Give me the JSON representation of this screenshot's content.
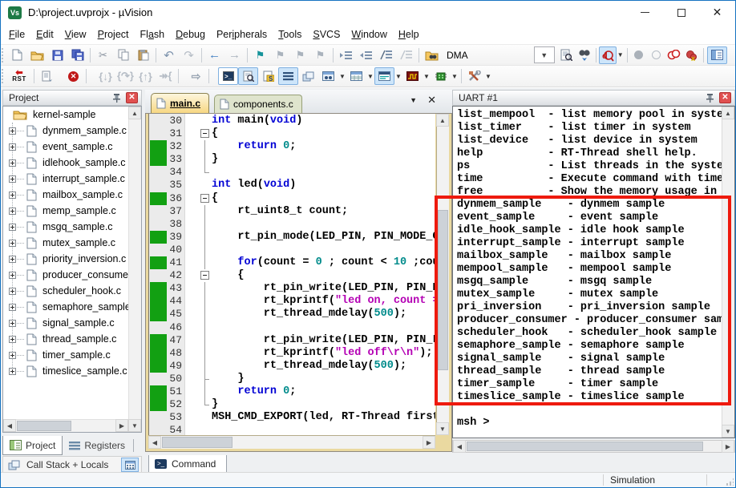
{
  "titlebar": {
    "title": "D:\\project.uvprojx - µVision",
    "icon_text": "Vs"
  },
  "menu": {
    "items": [
      {
        "pre": "",
        "u": "F",
        "post": "ile"
      },
      {
        "pre": "",
        "u": "E",
        "post": "dit"
      },
      {
        "pre": "",
        "u": "V",
        "post": "iew"
      },
      {
        "pre": "",
        "u": "P",
        "post": "roject"
      },
      {
        "pre": "Fl",
        "u": "a",
        "post": "sh"
      },
      {
        "pre": "",
        "u": "D",
        "post": "ebug"
      },
      {
        "pre": "Per",
        "u": "i",
        "post": "pherals"
      },
      {
        "pre": "",
        "u": "T",
        "post": "ools"
      },
      {
        "pre": "",
        "u": "S",
        "post": "VCS"
      },
      {
        "pre": "",
        "u": "W",
        "post": "indow"
      },
      {
        "pre": "",
        "u": "H",
        "post": "elp"
      }
    ]
  },
  "toolbar": {
    "combo_value": "DMA",
    "rst_label": "RST"
  },
  "project_panel": {
    "title": "Project",
    "root": "kernel-sample",
    "files": [
      "dynmem_sample.c",
      "event_sample.c",
      "idlehook_sample.c",
      "interrupt_sample.c",
      "mailbox_sample.c",
      "memp_sample.c",
      "msgq_sample.c",
      "mutex_sample.c",
      "priority_inversion.c",
      "producer_consumer.c",
      "scheduler_hook.c",
      "semaphore_sample.c",
      "signal_sample.c",
      "thread_sample.c",
      "timer_sample.c",
      "timeslice_sample.c"
    ],
    "tabs": {
      "project": "Project",
      "registers": "Registers"
    },
    "callstack_label": "Call Stack + Locals"
  },
  "editor": {
    "tabs": {
      "tab1": "main.c",
      "tab2": "components.c"
    },
    "command_tab": "Command",
    "lines": [
      {
        "n": 30,
        "g": false,
        "f": "",
        "segs": [
          [
            "k",
            "int"
          ],
          [
            "p",
            " main("
          ],
          [
            "k",
            "void"
          ],
          [
            "p",
            ")"
          ]
        ]
      },
      {
        "n": 31,
        "g": false,
        "f": "box",
        "segs": [
          [
            "p",
            "{"
          ]
        ]
      },
      {
        "n": 32,
        "g": true,
        "f": "v",
        "segs": [
          [
            "p",
            "    "
          ],
          [
            "k",
            "return"
          ],
          [
            "p",
            " "
          ],
          [
            "n",
            "0"
          ],
          [
            "p",
            ";"
          ]
        ]
      },
      {
        "n": 33,
        "g": true,
        "f": "v",
        "segs": [
          [
            "p",
            "}"
          ]
        ]
      },
      {
        "n": 34,
        "g": false,
        "f": "end",
        "segs": []
      },
      {
        "n": 35,
        "g": false,
        "f": "",
        "segs": [
          [
            "k",
            "int"
          ],
          [
            "p",
            " led("
          ],
          [
            "k",
            "void"
          ],
          [
            "p",
            ")"
          ]
        ]
      },
      {
        "n": 36,
        "g": true,
        "f": "box",
        "segs": [
          [
            "p",
            "{"
          ]
        ]
      },
      {
        "n": 37,
        "g": false,
        "f": "v",
        "segs": [
          [
            "p",
            "    rt_uint8_t count;"
          ]
        ]
      },
      {
        "n": 38,
        "g": false,
        "f": "v",
        "segs": []
      },
      {
        "n": 39,
        "g": true,
        "f": "v",
        "segs": [
          [
            "p",
            "    rt_pin_mode(LED_PIN, PIN_MODE_OUTPUT);"
          ]
        ]
      },
      {
        "n": 40,
        "g": false,
        "f": "v",
        "segs": []
      },
      {
        "n": 41,
        "g": true,
        "f": "v",
        "segs": [
          [
            "p",
            "    "
          ],
          [
            "k",
            "for"
          ],
          [
            "p",
            "(count = "
          ],
          [
            "n",
            "0"
          ],
          [
            "p",
            " ; count < "
          ],
          [
            "n",
            "10"
          ],
          [
            "p",
            " ;count++)"
          ]
        ]
      },
      {
        "n": 42,
        "g": false,
        "f": "box",
        "segs": [
          [
            "p",
            "    {"
          ]
        ]
      },
      {
        "n": 43,
        "g": true,
        "f": "v",
        "segs": [
          [
            "p",
            "        rt_pin_write(LED_PIN, PIN_HIGH);"
          ]
        ]
      },
      {
        "n": 44,
        "g": true,
        "f": "v",
        "segs": [
          [
            "p",
            "        rt_kprintf("
          ],
          [
            "s",
            "\"led on, count = %d\\r\\n\""
          ],
          [
            "p",
            ", count);"
          ]
        ]
      },
      {
        "n": 45,
        "g": true,
        "f": "v",
        "segs": [
          [
            "p",
            "        rt_thread_mdelay("
          ],
          [
            "n",
            "500"
          ],
          [
            "p",
            ");"
          ]
        ]
      },
      {
        "n": 46,
        "g": false,
        "f": "v",
        "segs": []
      },
      {
        "n": 47,
        "g": true,
        "f": "v",
        "segs": [
          [
            "p",
            "        rt_pin_write(LED_PIN, PIN_LOW);"
          ]
        ]
      },
      {
        "n": 48,
        "g": true,
        "f": "v",
        "segs": [
          [
            "p",
            "        rt_kprintf("
          ],
          [
            "s",
            "\"led off\\r\\n\""
          ],
          [
            "p",
            ");"
          ]
        ]
      },
      {
        "n": 49,
        "g": true,
        "f": "v",
        "segs": [
          [
            "p",
            "        rt_thread_mdelay("
          ],
          [
            "n",
            "500"
          ],
          [
            "p",
            ");"
          ]
        ]
      },
      {
        "n": 50,
        "g": false,
        "f": "vend",
        "segs": [
          [
            "p",
            "    }"
          ]
        ]
      },
      {
        "n": 51,
        "g": true,
        "f": "v",
        "segs": [
          [
            "p",
            "    "
          ],
          [
            "k",
            "return"
          ],
          [
            "p",
            " "
          ],
          [
            "n",
            "0"
          ],
          [
            "p",
            ";"
          ]
        ]
      },
      {
        "n": 52,
        "g": true,
        "f": "end",
        "segs": [
          [
            "p",
            "}"
          ]
        ]
      },
      {
        "n": 53,
        "g": false,
        "f": "",
        "segs": [
          [
            "p",
            "MSH_CMD_EXPORT(led, RT-Thread first led sample);"
          ]
        ]
      },
      {
        "n": 54,
        "g": false,
        "f": "",
        "segs": []
      }
    ]
  },
  "uart": {
    "title": "UART #1",
    "lines": [
      "list_mempool  - list memory pool in system",
      "list_timer    - list timer in system",
      "list_device   - list device in system",
      "help          - RT-Thread shell help.",
      "ps            - List threads in the system.",
      "time          - Execute command with time.",
      "free          - Show the memory usage in the system.",
      "dynmem_sample    - dynmem sample",
      "event_sample     - event sample",
      "idle_hook_sample - idle hook sample",
      "interrupt_sample - interrupt sample",
      "mailbox_sample   - mailbox sample",
      "mempool_sample   - mempool sample",
      "msgq_sample      - msgq sample",
      "mutex_sample     - mutex sample",
      "pri_inversion    - pri_inversion sample",
      "producer_consumer - producer_consumer sample",
      "scheduler_hook   - scheduler_hook sample",
      "semaphore_sample - semaphore sample",
      "signal_sample    - signal sample",
      "thread_sample    - thread sample",
      "timer_sample     - timer sample",
      "timeslice_sample - timeslice sample",
      "",
      "msh >"
    ],
    "highlight_color": "#ee1a0e"
  },
  "statusbar": {
    "mode": "Simulation"
  }
}
